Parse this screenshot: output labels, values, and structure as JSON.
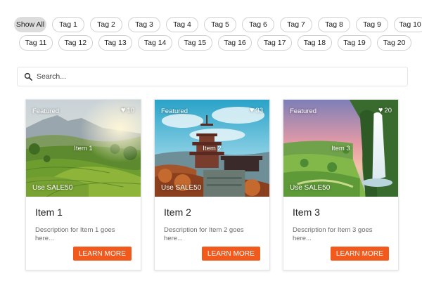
{
  "filters": {
    "tags": [
      "Show All",
      "Tag 1",
      "Tag 2",
      "Tag 3",
      "Tag 4",
      "Tag 5",
      "Tag 6",
      "Tag 7",
      "Tag 8",
      "Tag 9",
      "Tag 10",
      "Tag 11",
      "Tag 12",
      "Tag 13",
      "Tag 14",
      "Tag 15",
      "Tag 16",
      "Tag 17",
      "Tag 18",
      "Tag 19",
      "Tag 20"
    ],
    "active": "Show All"
  },
  "search": {
    "placeholder": "Search...",
    "icon": "search-icon"
  },
  "cards": [
    {
      "image_label": "Item 1",
      "badge": "Featured",
      "likes": "10",
      "promo": "Use SALE50",
      "title": "Item 1",
      "description": "Description for Item 1 goes here...",
      "button": "LEARN MORE"
    },
    {
      "image_label": "Item 2",
      "badge": "Featured",
      "likes": "33",
      "promo": "Use SALE50",
      "title": "Item 2",
      "description": "Description for Item 2 goes here...",
      "button": "LEARN MORE"
    },
    {
      "image_label": "Item 3",
      "badge": "Featured",
      "likes": "20",
      "promo": "Use SALE50",
      "title": "Item 3",
      "description": "Description for Item 3 goes here...",
      "button": "LEARN MORE"
    }
  ],
  "colors": {
    "accent": "#f25a1d",
    "active_tag": "#dcdcdc"
  }
}
